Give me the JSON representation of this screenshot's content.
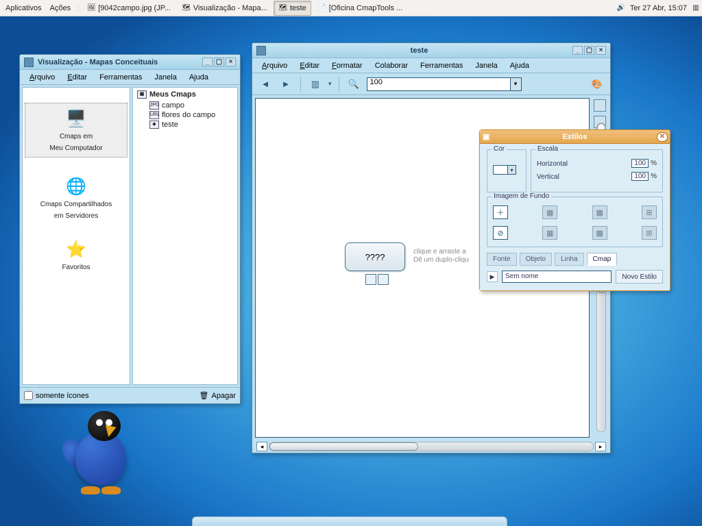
{
  "taskbar": {
    "menu_applications": "Aplicativos",
    "menu_actions": "Ações",
    "btn1": "[9042campo.jpg (JP...",
    "btn2": "Visualização - Mapa...",
    "btn3": "teste",
    "btn4": "[Oficina CmapTools ...",
    "clock": "Ter 27 Abr, 15:07"
  },
  "projects": {
    "title": "Visualização - Mapas Conceituais",
    "menubar": {
      "arquivo": "Arquivo",
      "editar": "Editar",
      "ferramentas": "Ferramentas",
      "janela": "Janela",
      "ajuda": "Ajuda"
    },
    "left": {
      "mycomputer_l1": "Cmaps em",
      "mycomputer_l2": "Meu Computador",
      "shared_l1": "Cmaps Compartilhados",
      "shared_l2": "em Servidores",
      "favorites": "Favoritos"
    },
    "right": {
      "header": "Meus Cmaps",
      "f1": "campo",
      "f2": "flores do campo",
      "f3": "teste"
    },
    "footer": {
      "only_icons": "somente ícones",
      "delete": "Apagar"
    }
  },
  "editor": {
    "title": "teste",
    "menubar": {
      "arquivo": "Arquivo",
      "editar": "Editar",
      "formatar": "Formatar",
      "colaborar": "Colaborar",
      "ferramentas": "Ferramentas",
      "janela": "Janela",
      "ajuda": "Ajuda"
    },
    "zoom": "100",
    "concept": "????",
    "hint_l1": "clique e arraste a",
    "hint_l2": "Dê um duplo-cliqu"
  },
  "styles": {
    "title": "Estilos",
    "cor": "Cor",
    "escala": "Escala",
    "horizontal": "Horizontal",
    "vertical": "Vertical",
    "h_val": "100",
    "v_val": "100",
    "pct": "%",
    "bg": "Imagem de Fundo",
    "tabs": {
      "fonte": "Fonte",
      "objeto": "Objeto",
      "linha": "Linha",
      "cmap": "Cmap"
    },
    "name": "Sem nome",
    "new": "Novo Estilo"
  }
}
